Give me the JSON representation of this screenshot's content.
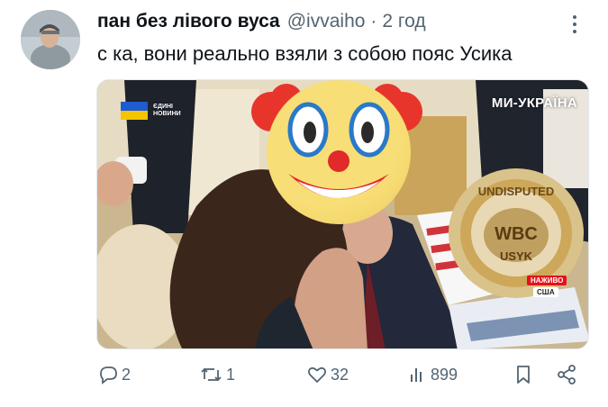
{
  "tweet": {
    "author_name": "пан без лівого вуса",
    "handle": "@ivvaiho",
    "separator": "·",
    "time": "2 год",
    "text": "с  ка, вони реально взяли з собою пояс Усика"
  },
  "media": {
    "watermark_right": "МИ-УКРАЇНА",
    "watermark_left": "ЄДИНІ НОВИНИ",
    "live_badge": "НАЖИВО",
    "location_badge": "США",
    "belt_top_text": "UNDISPUTED",
    "belt_center_text": "WBC",
    "belt_name_text": "USYK"
  },
  "actions": {
    "replies": "2",
    "reposts": "1",
    "likes": "32",
    "views": "899"
  },
  "icons": {
    "reply": "speech-bubble-icon",
    "repost": "retweet-icon",
    "like": "heart-icon",
    "views": "bar-chart-icon",
    "bookmark": "bookmark-icon",
    "share": "share-icon",
    "more": "more-vertical-icon"
  },
  "colors": {
    "text_primary": "#0f1419",
    "text_secondary": "#536471"
  }
}
